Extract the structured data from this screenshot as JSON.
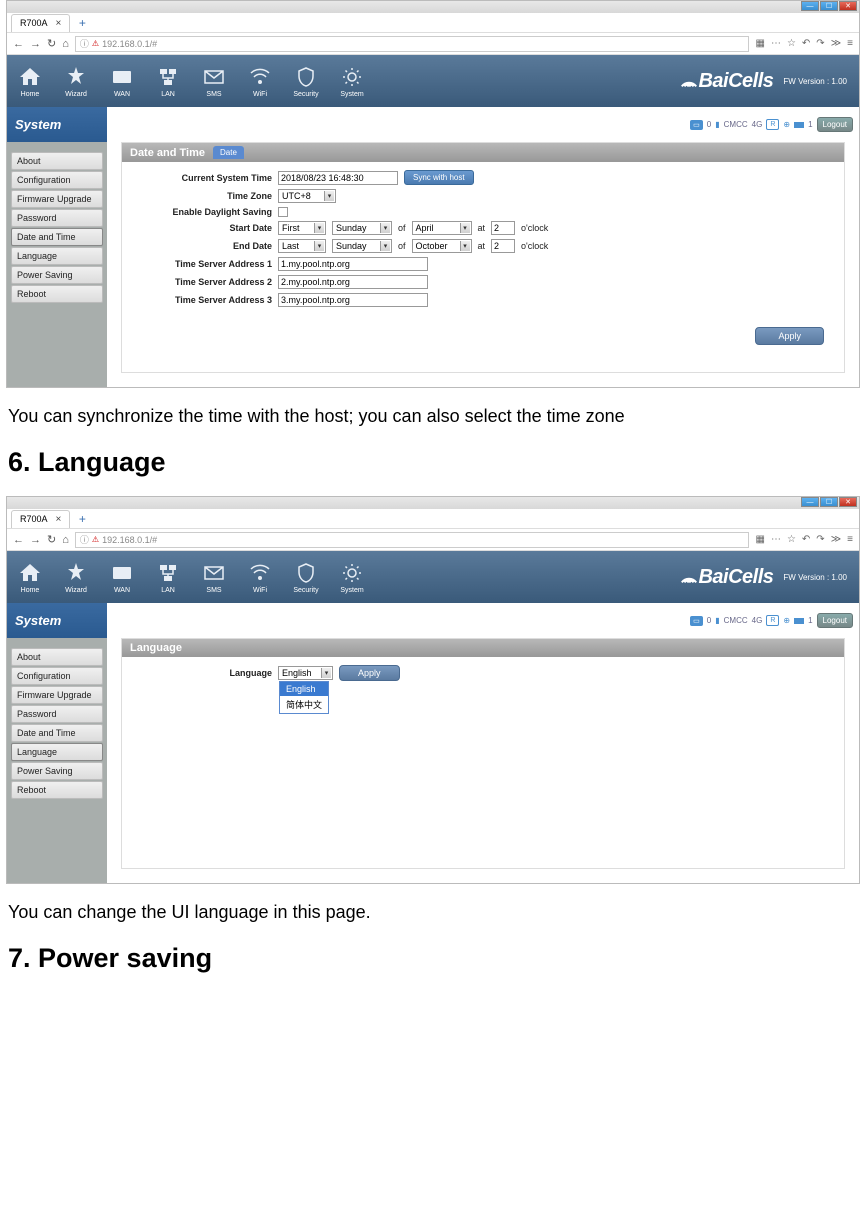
{
  "screenshot1": {
    "tab_title": "R700A",
    "url": "192.168.0.1/#",
    "fw_version": "FW Version : 1.00",
    "nav": [
      "Home",
      "Wizard",
      "WAN",
      "LAN",
      "SMS",
      "WiFi",
      "Security",
      "System"
    ],
    "brand": "BaiCells",
    "sidebar_title": "System",
    "sidebar_items": [
      "About",
      "Configuration",
      "Firmware Upgrade",
      "Password",
      "Date and Time",
      "Language",
      "Power Saving",
      "Reboot"
    ],
    "status": {
      "carrier": "CMCC",
      "net": "4G",
      "sig": "R",
      "count0": "0",
      "count1": "1",
      "logout": "Logout"
    },
    "panel_title": "Date and Time",
    "panel_tab": "Date",
    "fields": {
      "current_time_label": "Current System Time",
      "current_time_value": "2018/08/23 16:48:30",
      "sync_btn": "Sync with host",
      "tz_label": "Time Zone",
      "tz_value": "UTC+8",
      "dst_label": "Enable Daylight Saving",
      "start_label": "Start Date",
      "start_pos": "First",
      "start_day": "Sunday",
      "start_of": "of",
      "start_month": "April",
      "start_at": "at",
      "start_hour": "2",
      "start_oclock": "o'clock",
      "end_label": "End Date",
      "end_pos": "Last",
      "end_day": "Sunday",
      "end_of": "of",
      "end_month": "October",
      "end_at": "at",
      "end_hour": "2",
      "end_oclock": "o'clock",
      "ts1_label": "Time Server Address 1",
      "ts1_val": "1.my.pool.ntp.org",
      "ts2_label": "Time Server Address 2",
      "ts2_val": "2.my.pool.ntp.org",
      "ts3_label": "Time Server Address 3",
      "ts3_val": "3.my.pool.ntp.org",
      "apply": "Apply"
    }
  },
  "text_after_ss1": "You can synchronize the time with the host; you can also select the time zone",
  "heading6": "6. Language",
  "screenshot2": {
    "tab_title": "R700A",
    "url": "192.168.0.1/#",
    "fw_version": "FW Version : 1.00",
    "nav": [
      "Home",
      "Wizard",
      "WAN",
      "LAN",
      "SMS",
      "WiFi",
      "Security",
      "System"
    ],
    "brand": "BaiCells",
    "sidebar_title": "System",
    "sidebar_items": [
      "About",
      "Configuration",
      "Firmware Upgrade",
      "Password",
      "Date and Time",
      "Language",
      "Power Saving",
      "Reboot"
    ],
    "status": {
      "carrier": "CMCC",
      "net": "4G",
      "sig": "R",
      "count0": "0",
      "count1": "1",
      "logout": "Logout"
    },
    "panel_title": "Language",
    "fields": {
      "lang_label": "Language",
      "lang_value": "English",
      "opt_en": "English",
      "opt_zh": "简体中文",
      "apply": "Apply"
    }
  },
  "text_after_ss2": "You can change the UI language in this page.",
  "heading7": "7. Power saving"
}
